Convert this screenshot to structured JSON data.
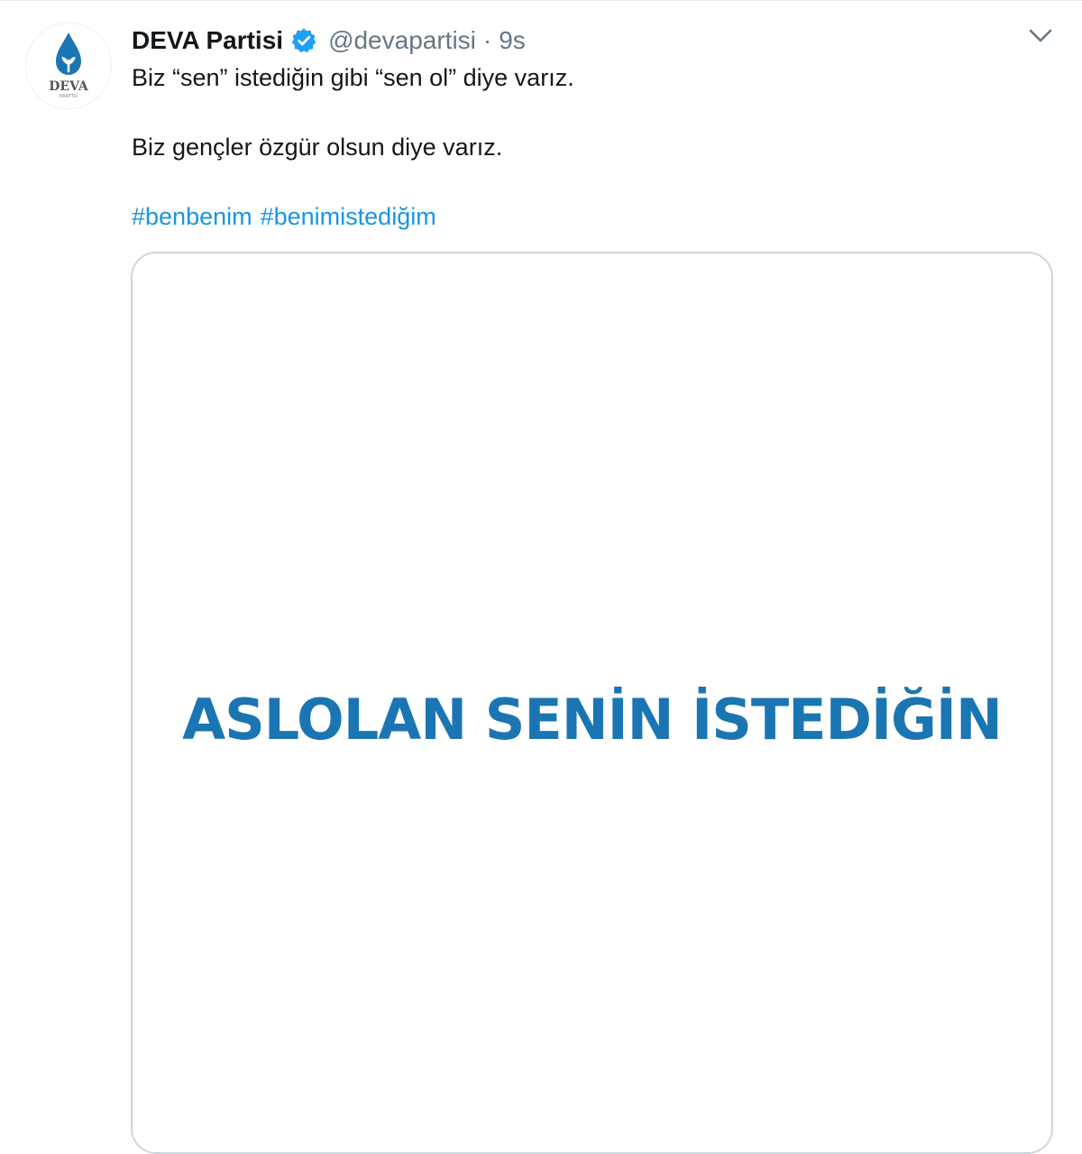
{
  "tweet": {
    "author": {
      "name": "DEVA Partisi",
      "handle": "@devapartisi",
      "verified": true,
      "avatar": {
        "icon": "deva-drop-logo",
        "logo_text": "DEVA",
        "logo_subtext": "PARTİSİ",
        "color": "#1b75b3"
      }
    },
    "separator": "·",
    "timestamp": "9s",
    "menu_icon": "chevron-down-icon",
    "text": {
      "line1": "Biz “sen” istediğin gibi “sen ol” diye varız.",
      "line2": "Biz gençler özgür olsun diye varız."
    },
    "hashtags": [
      "#benbenim",
      "#benimistediğim"
    ],
    "media": {
      "headline": "ASLOLAN SENİN İSTEDİĞİN"
    }
  },
  "colors": {
    "text": "#14171a",
    "muted": "#657786",
    "link": "#1b95e0",
    "verified": "#1da1f2",
    "brand": "#1b75b3",
    "border": "#ccd6dd"
  }
}
